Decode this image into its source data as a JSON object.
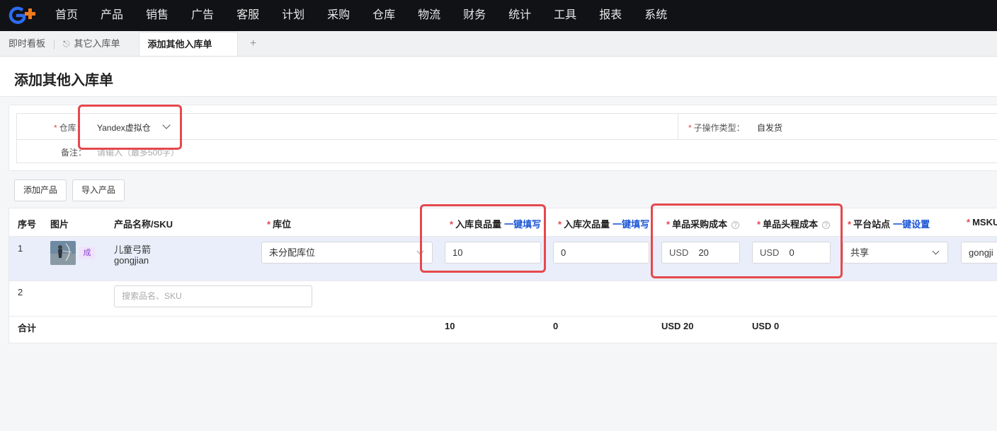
{
  "nav": {
    "items": [
      "首页",
      "产品",
      "销售",
      "广告",
      "客服",
      "计划",
      "采购",
      "仓库",
      "物流",
      "财务",
      "统计",
      "工具",
      "报表",
      "系统"
    ]
  },
  "tabs": {
    "items": [
      "即时看板",
      "其它入库单",
      "添加其他入库单"
    ],
    "add": "+"
  },
  "page": {
    "title": "添加其他入库单"
  },
  "form": {
    "warehouse_label": "仓库：",
    "warehouse_value": "Yandex虚拟仓",
    "sub_op_label": "子操作类型：",
    "sub_op_value": "自发货",
    "remark_label": "备注：",
    "remark_placeholder": "请输入（最多500字）"
  },
  "actions": {
    "add_product": "添加产品",
    "import_product": "导入产品"
  },
  "table": {
    "headers": {
      "seq": "序号",
      "image": "图片",
      "name_sku": "产品名称/SKU",
      "location": "库位",
      "good_qty": "入库良品量",
      "defect_qty": "入库次品量",
      "unit_purchase_cost": "单品采购成本",
      "unit_head_cost": "单品头程成本",
      "site": "平台站点",
      "msku": "MSKU"
    },
    "quick_fill": "一键填写",
    "quick_set": "一键设置",
    "help_mark": "?",
    "rows": [
      {
        "seq": "1",
        "badge": "成",
        "name": "儿童弓箭",
        "sku": "gongjian",
        "location": "未分配库位",
        "good_qty": "10",
        "defect_qty": "0",
        "purchase_currency": "USD",
        "purchase_cost": "20",
        "head_currency": "USD",
        "head_cost": "0",
        "site": "共享",
        "msku": "gongji"
      },
      {
        "seq": "2",
        "search_placeholder": "搜索品名、SKU"
      }
    ],
    "summary": {
      "label": "合计",
      "good_qty": "10",
      "defect_qty": "0",
      "purchase_cost": "USD 20",
      "head_cost": "USD 0"
    }
  },
  "colors": {
    "accent": "#1a55d6",
    "required": "#e5484d",
    "highlight": "#e5484d",
    "row_selected": "#eaeefa",
    "nav_bg": "#111216"
  }
}
